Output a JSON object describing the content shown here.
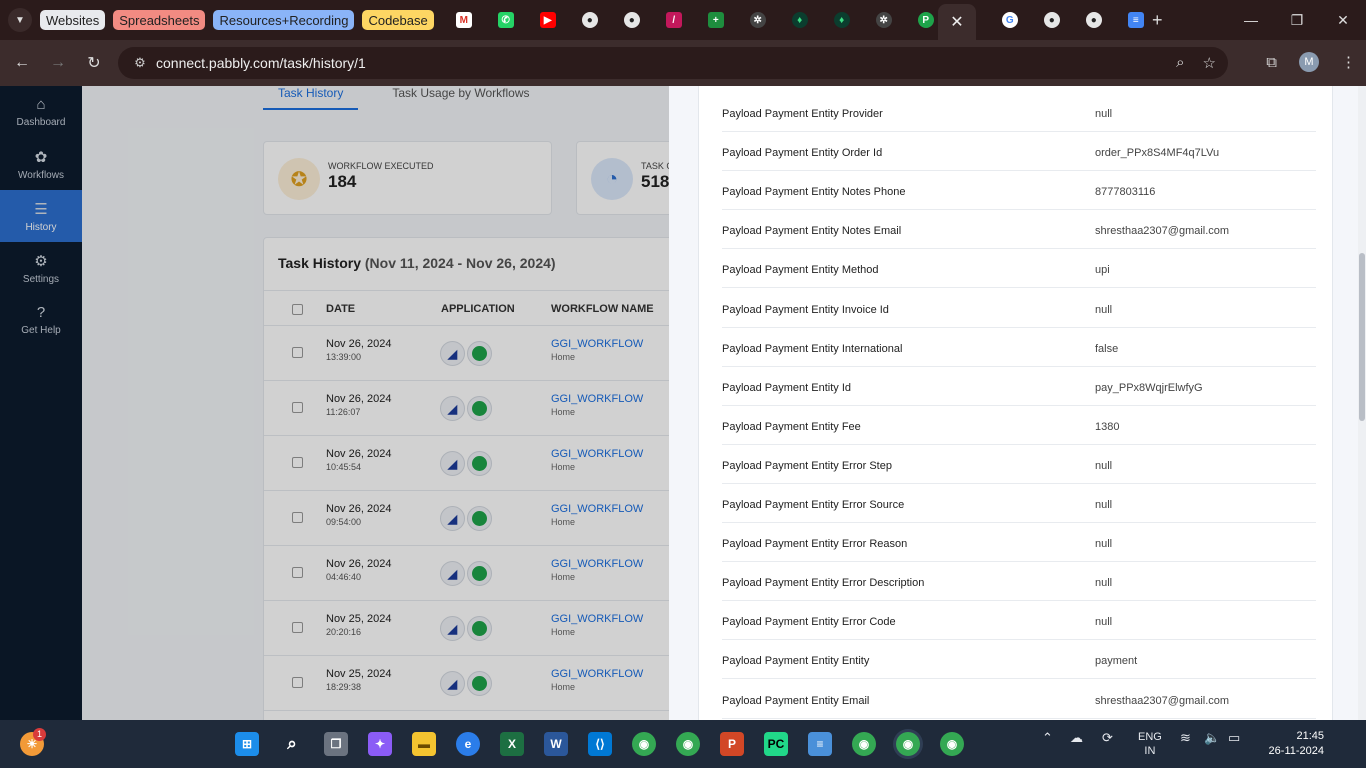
{
  "browser": {
    "tab_groups": [
      {
        "label": "Websites",
        "color": "#e8eaed"
      },
      {
        "label": "Spreadsheets",
        "color": "#f28b82"
      },
      {
        "label": "Resources+Recording",
        "color": "#8ab4f8"
      },
      {
        "label": "Codebase",
        "color": "#fdd663"
      }
    ],
    "url": "connect.pabbly.com/task/history/1"
  },
  "sidebar": {
    "items": [
      {
        "label": "Dashboard",
        "icon": "home-icon"
      },
      {
        "label": "Workflows",
        "icon": "workflow-icon"
      },
      {
        "label": "History",
        "icon": "history-icon"
      },
      {
        "label": "Settings",
        "icon": "gear-icon"
      },
      {
        "label": "Get Help",
        "icon": "help-icon"
      }
    ]
  },
  "main": {
    "tabs": [
      "Task History",
      "Task Usage by Workflows"
    ],
    "cards": [
      {
        "label": "WORKFLOW EXECUTED",
        "value": "184"
      },
      {
        "label": "TASK C",
        "value": "518"
      }
    ],
    "history_title": "Task History",
    "history_range": "(Nov 11, 2024 - Nov 26, 2024)",
    "columns": [
      "DATE",
      "APPLICATION",
      "WORKFLOW NAME"
    ],
    "rows": [
      {
        "date": "Nov 26, 2024",
        "time": "13:39:00",
        "workflow": "GGI_WORKFLOW",
        "folder": "Home"
      },
      {
        "date": "Nov 26, 2024",
        "time": "11:26:07",
        "workflow": "GGI_WORKFLOW",
        "folder": "Home"
      },
      {
        "date": "Nov 26, 2024",
        "time": "10:45:54",
        "workflow": "GGI_WORKFLOW",
        "folder": "Home"
      },
      {
        "date": "Nov 26, 2024",
        "time": "09:54:00",
        "workflow": "GGI_WORKFLOW",
        "folder": "Home"
      },
      {
        "date": "Nov 26, 2024",
        "time": "04:46:40",
        "workflow": "GGI_WORKFLOW",
        "folder": "Home"
      },
      {
        "date": "Nov 25, 2024",
        "time": "20:20:16",
        "workflow": "GGI_WORKFLOW",
        "folder": "Home"
      },
      {
        "date": "Nov 25, 2024",
        "time": "18:29:38",
        "workflow": "GGI_WORKFLOW",
        "folder": "Home"
      }
    ]
  },
  "panel": {
    "fields": [
      {
        "key": "Payload Payment Entity Provider",
        "value": "null"
      },
      {
        "key": "Payload Payment Entity Order Id",
        "value": "order_PPx8S4MF4q7LVu"
      },
      {
        "key": "Payload Payment Entity Notes Phone",
        "value": "8777803116"
      },
      {
        "key": "Payload Payment Entity Notes Email",
        "value": "shresthaa2307@gmail.com"
      },
      {
        "key": "Payload Payment Entity Method",
        "value": "upi"
      },
      {
        "key": "Payload Payment Entity Invoice Id",
        "value": "null"
      },
      {
        "key": "Payload Payment Entity International",
        "value": "false"
      },
      {
        "key": "Payload Payment Entity Id",
        "value": "pay_PPx8WqjrElwfyG"
      },
      {
        "key": "Payload Payment Entity Fee",
        "value": "1380"
      },
      {
        "key": "Payload Payment Entity Error Step",
        "value": "null"
      },
      {
        "key": "Payload Payment Entity Error Source",
        "value": "null"
      },
      {
        "key": "Payload Payment Entity Error Reason",
        "value": "null"
      },
      {
        "key": "Payload Payment Entity Error Description",
        "value": "null"
      },
      {
        "key": "Payload Payment Entity Error Code",
        "value": "null"
      },
      {
        "key": "Payload Payment Entity Entity",
        "value": "payment"
      },
      {
        "key": "Payload Payment Entity Email",
        "value": "shresthaa2307@gmail.com"
      }
    ]
  },
  "taskbar": {
    "lang": "ENG",
    "region": "IN",
    "time": "21:45",
    "date": "26-11-2024",
    "notif_count": "1"
  }
}
